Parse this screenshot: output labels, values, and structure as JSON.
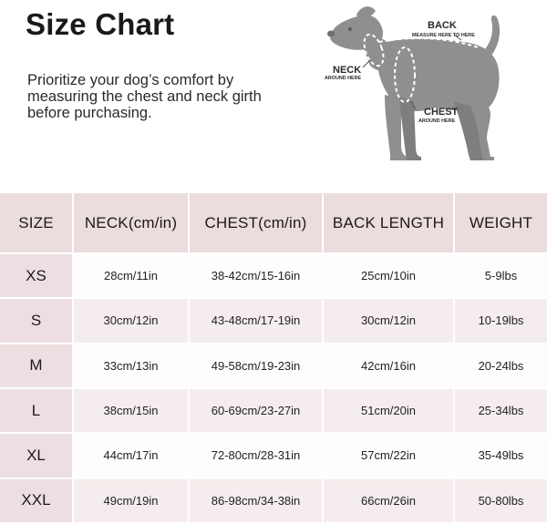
{
  "title": "Size Chart",
  "intro": "Prioritize your dog’s comfort by measuring the chest and neck girth before purchasing.",
  "diagram": {
    "back_label": "BACK",
    "back_sublabel": "MEASURE HERE TO HERE",
    "neck_label": "NECK",
    "neck_sublabel": "AROUND HERE",
    "chest_label": "CHEST",
    "chest_sublabel": "AROUND HERE",
    "dog_color": "#8f8f8f",
    "dash_color": "#ffffff"
  },
  "table": {
    "headers": [
      "SIZE",
      "NECK(cm/in)",
      "CHEST(cm/in)",
      "BACK LENGTH",
      "WEIGHT"
    ],
    "rows": [
      [
        "XS",
        "28cm/11in",
        "38-42cm/15-16in",
        "25cm/10in",
        "5-9lbs"
      ],
      [
        "S",
        "30cm/12in",
        "43-48cm/17-19in",
        "30cm/12in",
        "10-19lbs"
      ],
      [
        "M",
        "33cm/13in",
        "49-58cm/19-23in",
        "42cm/16in",
        "20-24lbs"
      ],
      [
        "L",
        "38cm/15in",
        "60-69cm/23-27in",
        "51cm/20in",
        "25-34lbs"
      ],
      [
        "XL",
        "44cm/17in",
        "72-80cm/28-31in",
        "57cm/22in",
        "35-49lbs"
      ],
      [
        "XXL",
        "49cm/19in",
        "86-98cm/34-38in",
        "66cm/26in",
        "50-80lbs"
      ]
    ],
    "header_bg": "#ebdcde",
    "size_col_bg": "#eddfe1",
    "row_bg_light": "#fefcfc",
    "row_bg_dark": "#f5eded"
  }
}
